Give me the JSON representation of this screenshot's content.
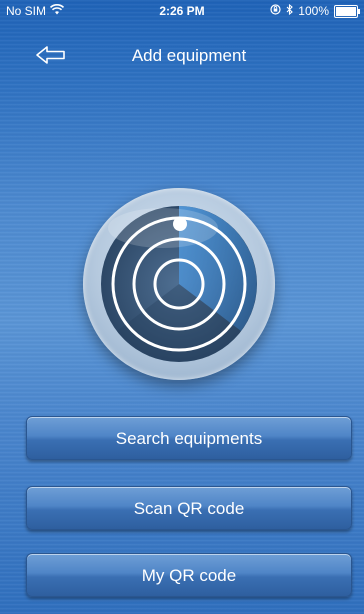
{
  "status_bar": {
    "carrier": "No SIM",
    "time": "2:26 PM",
    "battery": "100%",
    "battery_level": 1.0,
    "icons": [
      "wifi-icon",
      "orientation-lock-icon",
      "bluetooth-icon",
      "battery-icon"
    ]
  },
  "nav": {
    "title": "Add equipment",
    "back_icon": "back-arrow-icon"
  },
  "radar": {
    "icon": "radar-icon"
  },
  "buttons": {
    "search": "Search equipments",
    "scan": "Scan QR code",
    "my_qr": "My QR code"
  },
  "colors": {
    "background_top": "#1f63b8",
    "background_mid": "#5a95d6",
    "button": "#4f85c7",
    "radar_dark": "#3b5b7d",
    "radar_sweep": "#3a86d8"
  }
}
